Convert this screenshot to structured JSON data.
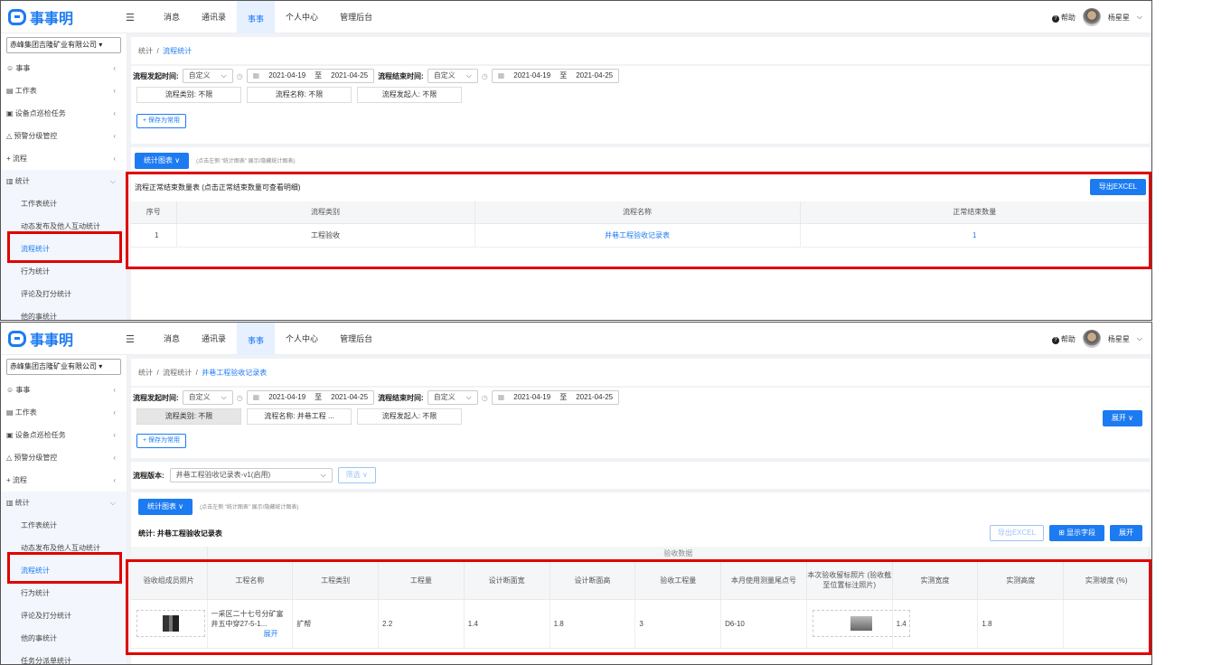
{
  "app": {
    "logo_text": "事事明",
    "nav": [
      "消息",
      "通讯录",
      "事事",
      "个人中心",
      "管理后台"
    ],
    "help": "帮助",
    "user": "杨星星",
    "company": "赤峰集团吉隆矿业有限公司",
    "sidebar": {
      "top_items": [
        "事事",
        "工作表",
        "设备点巡检任务",
        "预警分级管控",
        "流程",
        "统计"
      ],
      "stat_subs_top": [
        "工作表统计",
        "动态发布及他人互动统计",
        "流程统计",
        "行为统计",
        "评论及打分统计",
        "他的事统计"
      ],
      "stat_subs_bottom": [
        "工作表统计",
        "动态发布及他人互动统计",
        "流程统计",
        "行为统计",
        "评论及打分统计",
        "他的事统计",
        "任务分派单统计"
      ]
    }
  },
  "filters": {
    "start_label": "流程发起时间:",
    "end_label": "流程结束时间:",
    "preset": "自定义",
    "from": "2021-04-19",
    "to_word": "至",
    "to": "2021-04-25",
    "save_common": "+ 保存为常用"
  },
  "top": {
    "breadcrumb": [
      "统计",
      "流程统计"
    ],
    "chips": [
      "流程类别: 不限",
      "流程名称: 不限",
      "流程发起人: 不限"
    ],
    "stats_btn": "统计图表 ∨",
    "hint": "(点击左侧 \"统计图表\" 展示/隐藏统计图表)",
    "table_title": "流程正常结束数量表 (点击正常结束数量可查看明细)",
    "export": "导出EXCEL",
    "columns": [
      "序号",
      "流程类别",
      "流程名称",
      "正常结束数量"
    ],
    "rows": [
      [
        "1",
        "工程验收",
        "井巷工程验收记录表",
        "1"
      ]
    ]
  },
  "bottom": {
    "breadcrumb": [
      "统计",
      "流程统计",
      "井巷工程验收记录表"
    ],
    "chips": [
      "流程类别: 不限",
      "流程名称: 井巷工程 ...",
      "流程发起人: 不限"
    ],
    "expand": "展开 ∨",
    "version_label": "流程版本:",
    "version_value": "井巷工程验收记录表-v1(启用)",
    "filter_btn": "筛选 ∨",
    "stats_btn": "统计图表 ∨",
    "hint": "(点击左侧 \"统计图表\" 展示/隐藏统计图表)",
    "table_title": "统计: 井巷工程验收记录表",
    "export": "导出EXCEL",
    "show_fields": "显示字段",
    "expand2": "展开",
    "group_header": "验收数据",
    "columns": [
      "验收组成员照片",
      "工程名称",
      "工程类别",
      "工程量",
      "设计断面宽",
      "设计断面高",
      "验收工程量",
      "本月使用测量尾点号",
      "本次验收留标照片 (验收截至位置标注照片)",
      "实测宽度",
      "实测高度",
      "实测坡度 (%)"
    ],
    "row": {
      "name": "一采区二十七号分矿富井五中穿27-5-1...",
      "more": "展开",
      "category": "扩帮",
      "qty": "2.2",
      "width": "1.4",
      "height": "1.8",
      "accepted": "3",
      "point": "D6-10",
      "real_w": "1.4",
      "real_h": "1.8",
      "slope": ""
    }
  }
}
